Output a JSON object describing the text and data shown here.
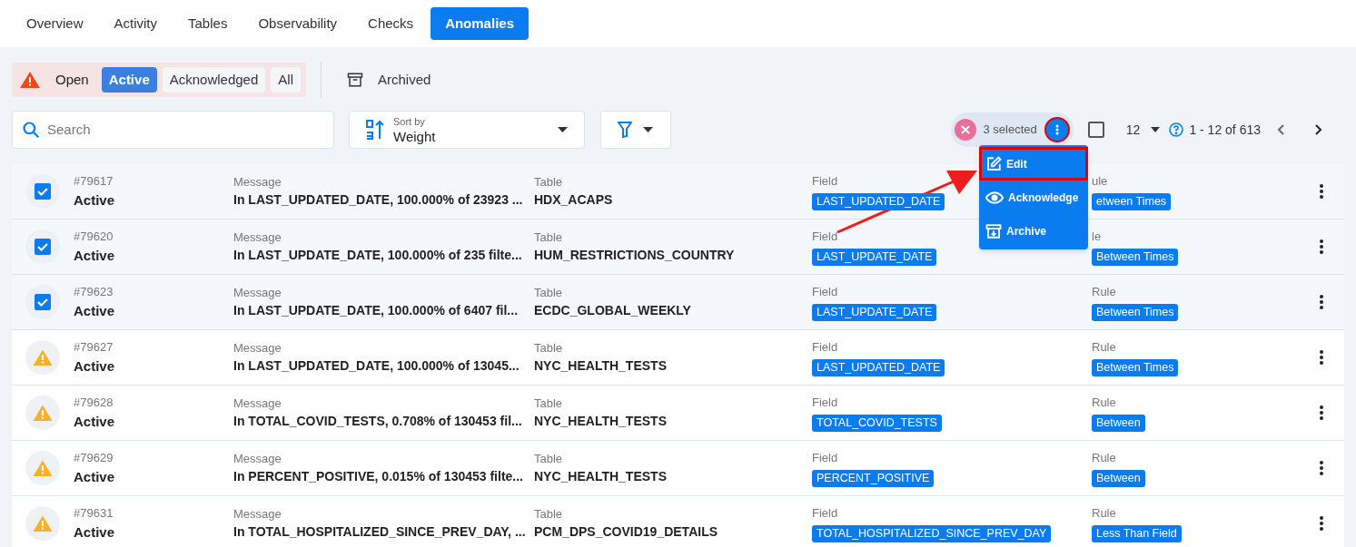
{
  "tabs": [
    {
      "label": "Overview",
      "selected": false
    },
    {
      "label": "Activity",
      "selected": false
    },
    {
      "label": "Tables",
      "selected": false
    },
    {
      "label": "Observability",
      "selected": false
    },
    {
      "label": "Checks",
      "selected": false
    },
    {
      "label": "Anomalies",
      "selected": true
    }
  ],
  "status_filter": {
    "label": "Open",
    "options": [
      {
        "label": "Active",
        "selected": true
      },
      {
        "label": "Acknowledged",
        "selected": false
      },
      {
        "label": "All",
        "selected": false
      }
    ]
  },
  "archived": {
    "label": "Archived"
  },
  "search": {
    "placeholder": "Search"
  },
  "sort": {
    "caption": "Sort by",
    "value": "Weight"
  },
  "selection": {
    "all_selected": false,
    "count": "3 selected",
    "page_size": "12",
    "range": "1 - 12 of 613"
  },
  "bulk_menu": [
    {
      "kind": "edit",
      "label": "Edit",
      "highlighted": true
    },
    {
      "kind": "acknowledge",
      "label": "Acknowledge",
      "highlighted": false
    },
    {
      "kind": "archive",
      "label": "Archive",
      "highlighted": false
    }
  ],
  "rows": [
    {
      "id": "#79617",
      "status": "Active",
      "selected": true,
      "message_label": "Message",
      "message": "In LAST_UPDATED_DATE, 100.000% of 23923 ...",
      "table_label": "Table",
      "table": "HDX_ACAPS",
      "field_label": "Field",
      "field": "LAST_UPDATED_DATE",
      "rule_label": "ule",
      "rule": "etween Times"
    },
    {
      "id": "#79620",
      "status": "Active",
      "selected": true,
      "message_label": "Message",
      "message": "In LAST_UPDATE_DATE, 100.000% of 235 filte...",
      "table_label": "Table",
      "table": "HUM_RESTRICTIONS_COUNTRY",
      "field_label": "Field",
      "field": "LAST_UPDATE_DATE",
      "rule_label": "le",
      "rule": "Between Times"
    },
    {
      "id": "#79623",
      "status": "Active",
      "selected": true,
      "message_label": "Message",
      "message": "In LAST_UPDATE_DATE, 100.000% of 6407 fil...",
      "table_label": "Table",
      "table": "ECDC_GLOBAL_WEEKLY",
      "field_label": "Field",
      "field": "LAST_UPDATE_DATE",
      "rule_label": "Rule",
      "rule": "Between Times"
    },
    {
      "id": "#79627",
      "status": "Active",
      "selected": false,
      "message_label": "Message",
      "message": "In LAST_UPDATED_DATE, 100.000% of 13045...",
      "table_label": "Table",
      "table": "NYC_HEALTH_TESTS",
      "field_label": "Field",
      "field": "LAST_UPDATED_DATE",
      "rule_label": "Rule",
      "rule": "Between Times"
    },
    {
      "id": "#79628",
      "status": "Active",
      "selected": false,
      "message_label": "Message",
      "message": "In TOTAL_COVID_TESTS, 0.708% of 130453 fil...",
      "table_label": "Table",
      "table": "NYC_HEALTH_TESTS",
      "field_label": "Field",
      "field": "TOTAL_COVID_TESTS",
      "rule_label": "Rule",
      "rule": "Between"
    },
    {
      "id": "#79629",
      "status": "Active",
      "selected": false,
      "message_label": "Message",
      "message": "In PERCENT_POSITIVE, 0.015% of 130453 filte...",
      "table_label": "Table",
      "table": "NYC_HEALTH_TESTS",
      "field_label": "Field",
      "field": "PERCENT_POSITIVE",
      "rule_label": "Rule",
      "rule": "Between"
    },
    {
      "id": "#79631",
      "status": "Active",
      "selected": false,
      "message_label": "Message",
      "message": "In TOTAL_HOSPITALIZED_SINCE_PREV_DAY, ...",
      "table_label": "Table",
      "table": "PCM_DPS_COVID19_DETAILS",
      "field_label": "Field",
      "field": "TOTAL_HOSPITALIZED_SINCE_PREV_DAY",
      "rule_label": "Rule",
      "rule": "Less Than Field"
    }
  ]
}
